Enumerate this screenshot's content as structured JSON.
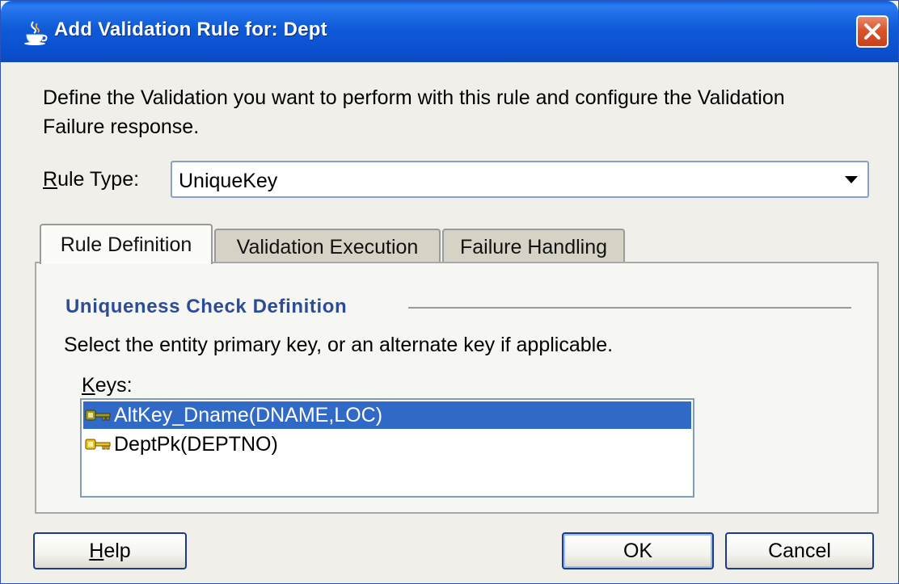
{
  "dialog": {
    "title": "Add Validation Rule for: Dept",
    "title_icon": "java-cup-icon",
    "close_icon": "close-icon"
  },
  "description": "Define the Validation you want to perform with this rule and configure the Validation Failure response.",
  "rule_type": {
    "label_mnemonic": "R",
    "label_rest": "ule Type:",
    "value": "UniqueKey"
  },
  "tabs": [
    {
      "label": "Rule Definition",
      "active": true
    },
    {
      "label": "Validation Execution",
      "active": false
    },
    {
      "label": "Failure Handling",
      "active": false
    }
  ],
  "panel": {
    "section_title": "Uniqueness Check Definition",
    "instruction": "Select the entity primary key, or an alternate key if applicable.",
    "keys_label_mnemonic": "K",
    "keys_label_rest": "eys:",
    "keys": [
      {
        "label": "AltKey_Dname(DNAME,LOC)",
        "icon": "alternate-key-icon",
        "selected": true
      },
      {
        "label": "DeptPk(DEPTNO)",
        "icon": "primary-key-icon",
        "selected": false
      }
    ]
  },
  "buttons": {
    "help_mnemonic": "H",
    "help_rest": "elp",
    "ok": "OK",
    "cancel": "Cancel"
  },
  "colors": {
    "titlebar": "#0a5fd8",
    "selection": "#3169c6",
    "section_title": "#2c4c96",
    "close_button": "#d9542c"
  }
}
